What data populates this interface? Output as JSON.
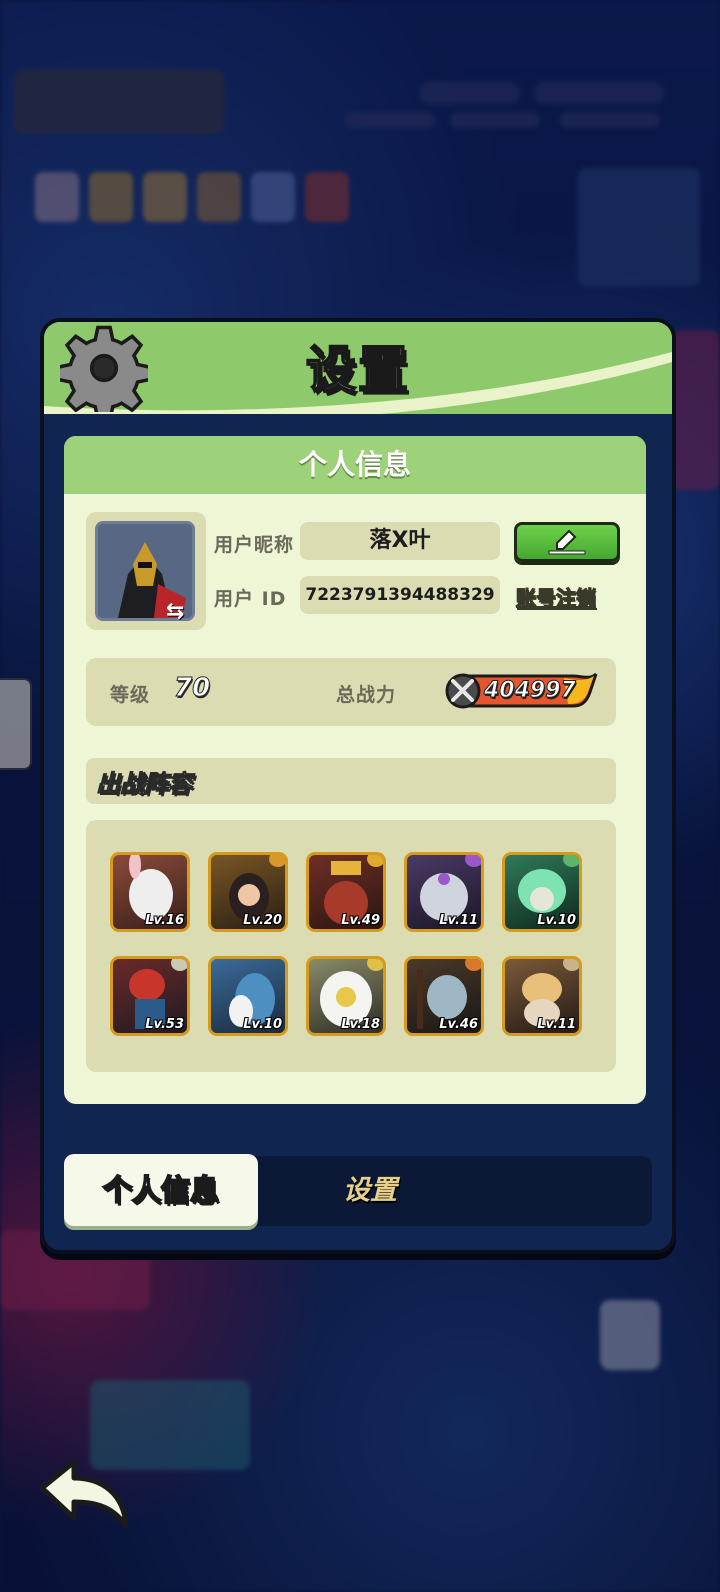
{
  "dialog": {
    "title": "设置"
  },
  "personal_info": {
    "header": "个人信息",
    "nickname_label": "用户昵称",
    "nickname_value": "落X叶",
    "id_label": "用户 ID",
    "id_value": "7223791394488329",
    "account_cancel": "账号注销"
  },
  "stats": {
    "level_label": "等级",
    "level_value": "70",
    "power_label": "总战力",
    "power_value": "404997"
  },
  "team": {
    "title": "出战阵容",
    "heroes": [
      {
        "level": "Lv.16"
      },
      {
        "level": "Lv.20"
      },
      {
        "level": "Lv.49"
      },
      {
        "level": "Lv.11"
      },
      {
        "level": "Lv.10"
      },
      {
        "level": "Lv.53"
      },
      {
        "level": "Lv.10"
      },
      {
        "level": "Lv.18"
      },
      {
        "level": "Lv.46"
      },
      {
        "level": "Lv.11"
      }
    ]
  },
  "tabs": {
    "active": "个人信息",
    "inactive": "设置"
  },
  "icons": {
    "gear": "gear-icon",
    "edit": "pencil-icon",
    "swap": "swap-arrows-icon",
    "power": "crossed-swords-icon",
    "back": "back-arrow-icon"
  }
}
